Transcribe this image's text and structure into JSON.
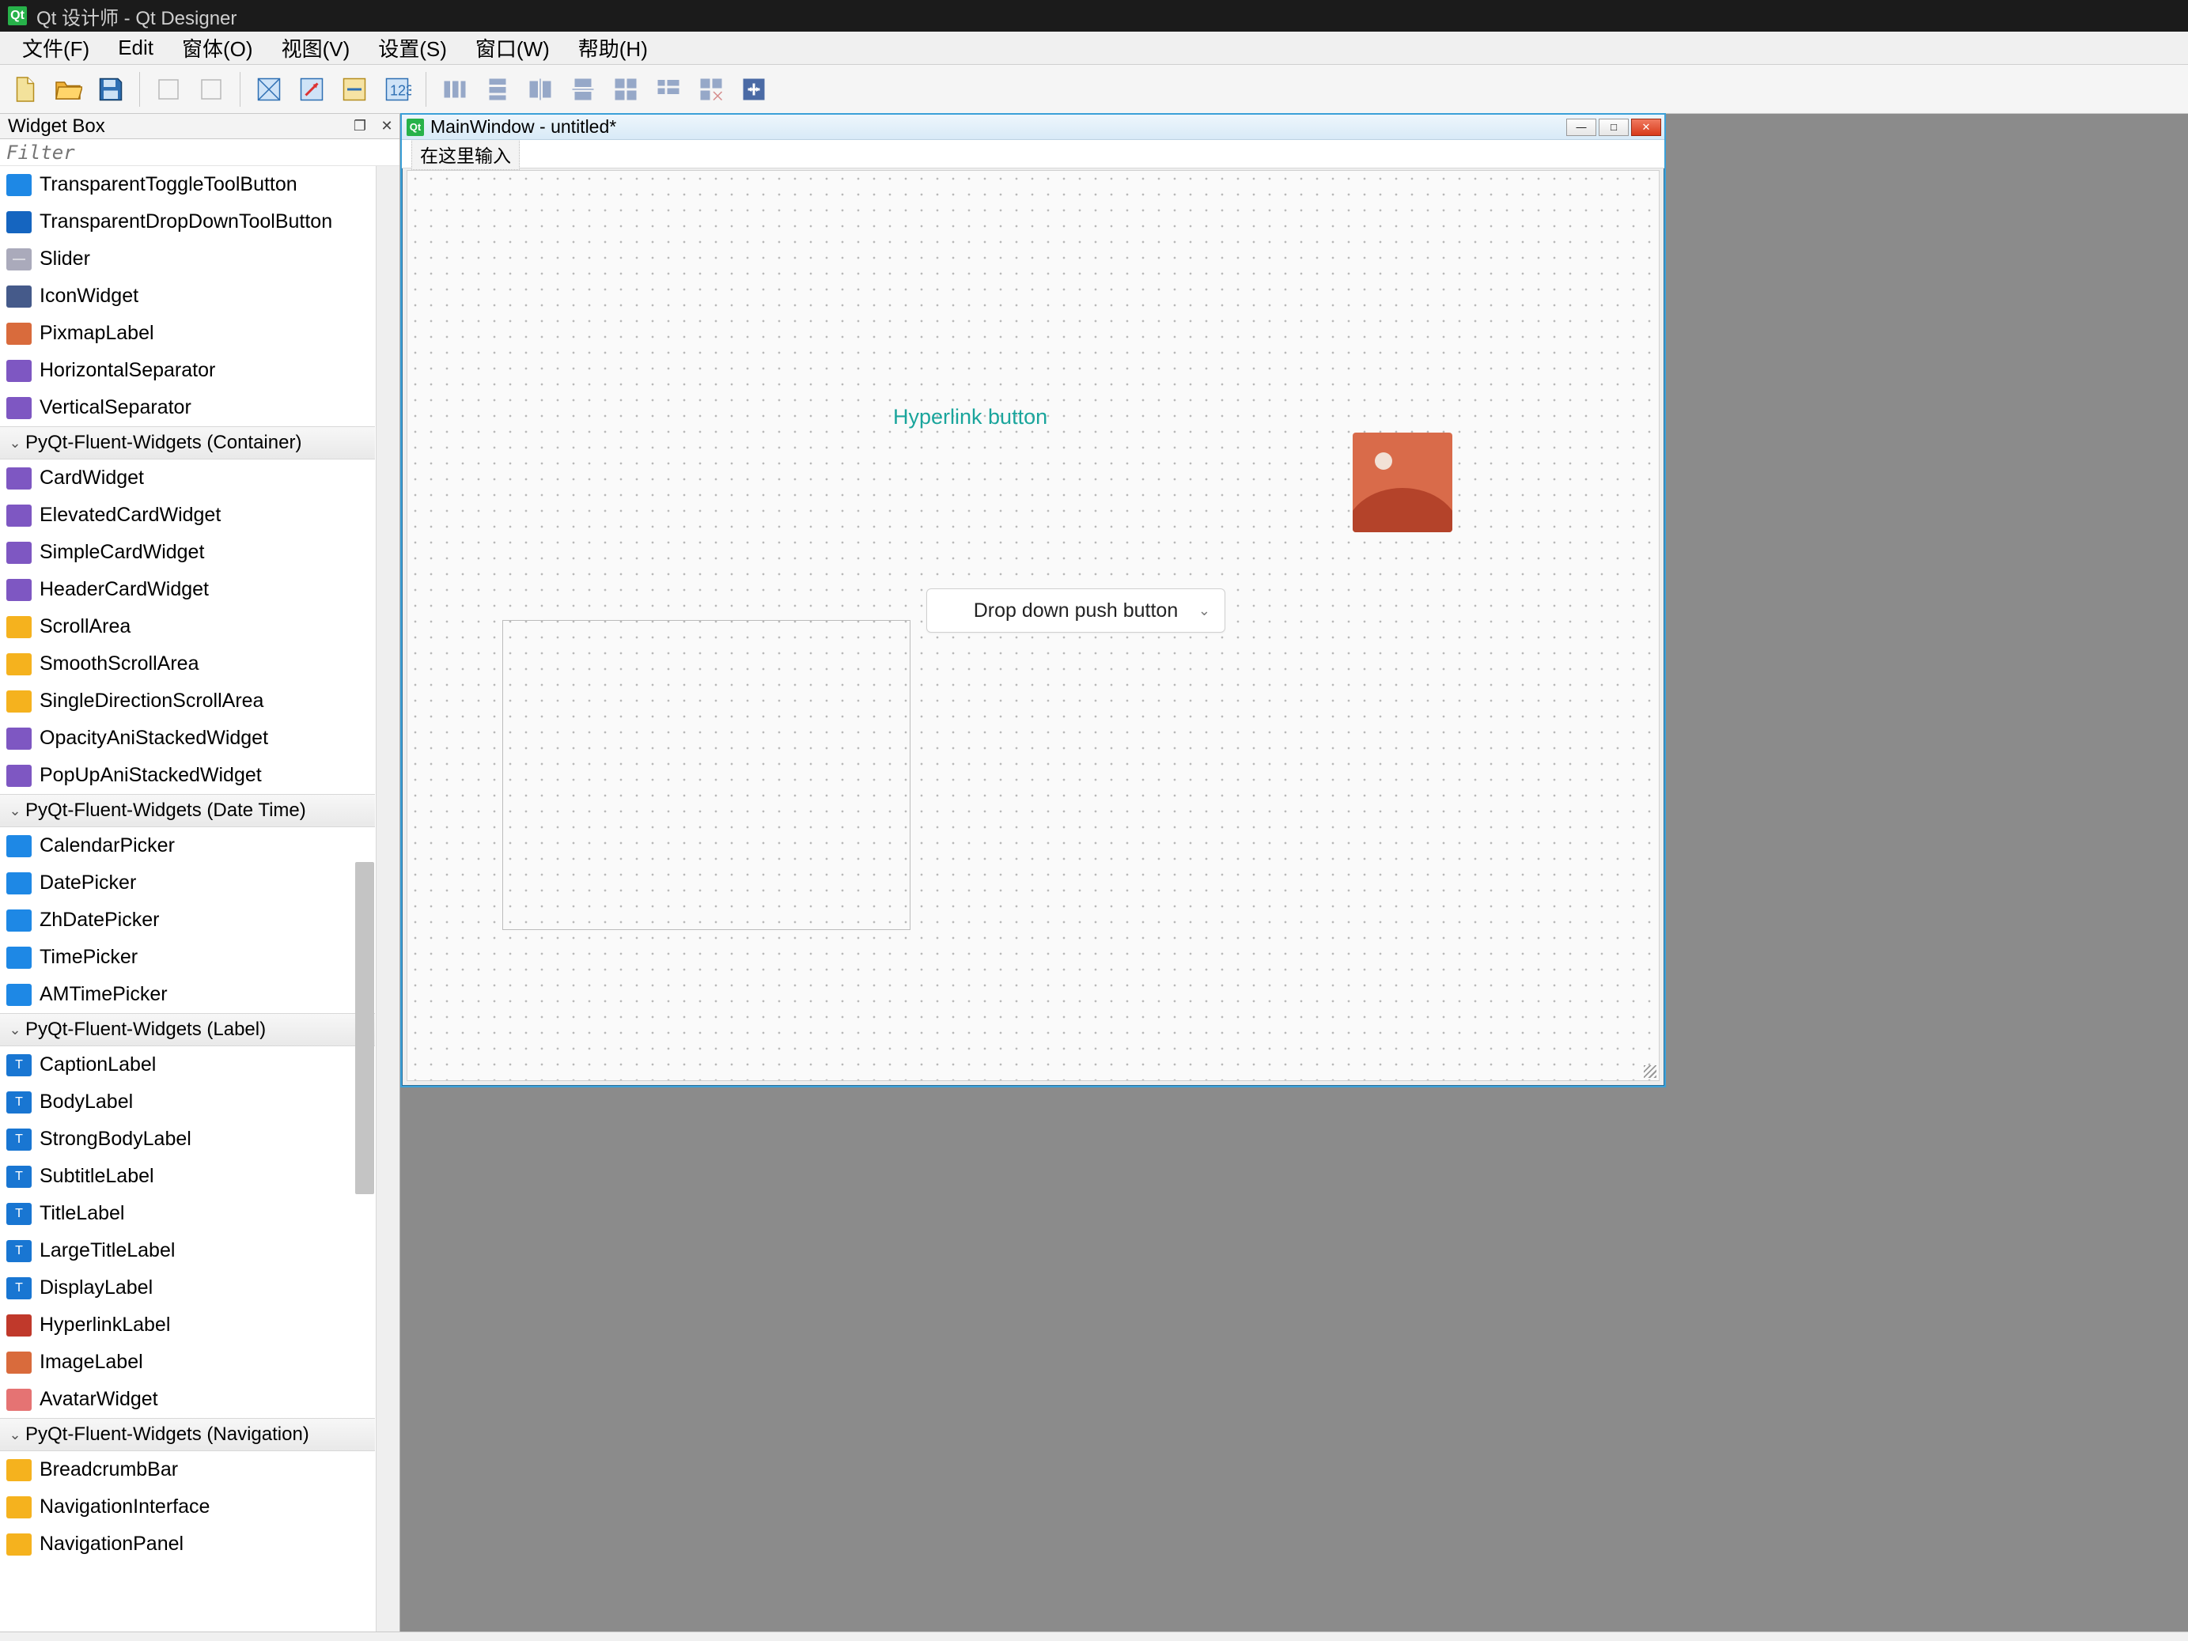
{
  "title": "Qt 设计师 - Qt Designer",
  "menus": [
    "文件(F)",
    "Edit",
    "窗体(O)",
    "视图(V)",
    "设置(S)",
    "窗口(W)",
    "帮助(H)"
  ],
  "widgetbox": {
    "header": "Widget Box",
    "filter_placeholder": "Filter",
    "groups": [
      {
        "type": "item",
        "icon": "blue",
        "label": "TransparentToggleToolButton"
      },
      {
        "type": "item",
        "icon": "dblue",
        "label": "TransparentDropDownToolButton"
      },
      {
        "type": "item",
        "icon": "greybar",
        "label": "Slider"
      },
      {
        "type": "item",
        "icon": "dkslate",
        "label": "IconWidget"
      },
      {
        "type": "item",
        "icon": "orange",
        "label": "PixmapLabel"
      },
      {
        "type": "item",
        "icon": "purple",
        "label": "HorizontalSeparator"
      },
      {
        "type": "item",
        "icon": "purple",
        "label": "VerticalSeparator"
      },
      {
        "type": "cat",
        "label": "PyQt-Fluent-Widgets (Container)"
      },
      {
        "type": "item",
        "icon": "purple",
        "label": "CardWidget"
      },
      {
        "type": "item",
        "icon": "purple",
        "label": "ElevatedCardWidget"
      },
      {
        "type": "item",
        "icon": "purple",
        "label": "SimpleCardWidget"
      },
      {
        "type": "item",
        "icon": "purple",
        "label": "HeaderCardWidget"
      },
      {
        "type": "item",
        "icon": "yellow",
        "label": "ScrollArea"
      },
      {
        "type": "item",
        "icon": "yellow",
        "label": "SmoothScrollArea"
      },
      {
        "type": "item",
        "icon": "yellow",
        "label": "SingleDirectionScrollArea"
      },
      {
        "type": "item",
        "icon": "purple",
        "label": "OpacityAniStackedWidget"
      },
      {
        "type": "item",
        "icon": "purple",
        "label": "PopUpAniStackedWidget"
      },
      {
        "type": "cat",
        "label": "PyQt-Fluent-Widgets (Date Time)"
      },
      {
        "type": "item",
        "icon": "blue",
        "label": "CalendarPicker"
      },
      {
        "type": "item",
        "icon": "blue",
        "label": "DatePicker"
      },
      {
        "type": "item",
        "icon": "blue",
        "label": "ZhDatePicker"
      },
      {
        "type": "item",
        "icon": "blue",
        "label": "TimePicker"
      },
      {
        "type": "item",
        "icon": "blue",
        "label": "AMTimePicker"
      },
      {
        "type": "cat",
        "label": "PyQt-Fluent-Widgets (Label)"
      },
      {
        "type": "item",
        "icon": "T",
        "label": "CaptionLabel"
      },
      {
        "type": "item",
        "icon": "T",
        "label": "BodyLabel"
      },
      {
        "type": "item",
        "icon": "T",
        "label": "StrongBodyLabel"
      },
      {
        "type": "item",
        "icon": "T",
        "label": "SubtitleLabel"
      },
      {
        "type": "item",
        "icon": "T",
        "label": "TitleLabel"
      },
      {
        "type": "item",
        "icon": "T",
        "label": "LargeTitleLabel"
      },
      {
        "type": "item",
        "icon": "T",
        "label": "DisplayLabel"
      },
      {
        "type": "item",
        "icon": "red",
        "label": "HyperlinkLabel"
      },
      {
        "type": "item",
        "icon": "orange",
        "label": "ImageLabel"
      },
      {
        "type": "item",
        "icon": "pink",
        "label": "AvatarWidget"
      },
      {
        "type": "cat",
        "label": "PyQt-Fluent-Widgets (Navigation)"
      },
      {
        "type": "item",
        "icon": "yellow",
        "label": "BreadcrumbBar"
      },
      {
        "type": "item",
        "icon": "yellow",
        "label": "NavigationInterface"
      },
      {
        "type": "item",
        "icon": "yellow",
        "label": "NavigationPanel"
      }
    ]
  },
  "inner_window": {
    "title": "MainWindow - untitled*",
    "menu_placeholder": "在这里输入",
    "hyperlink": "Hyperlink button",
    "dropdown": "Drop down push button"
  }
}
